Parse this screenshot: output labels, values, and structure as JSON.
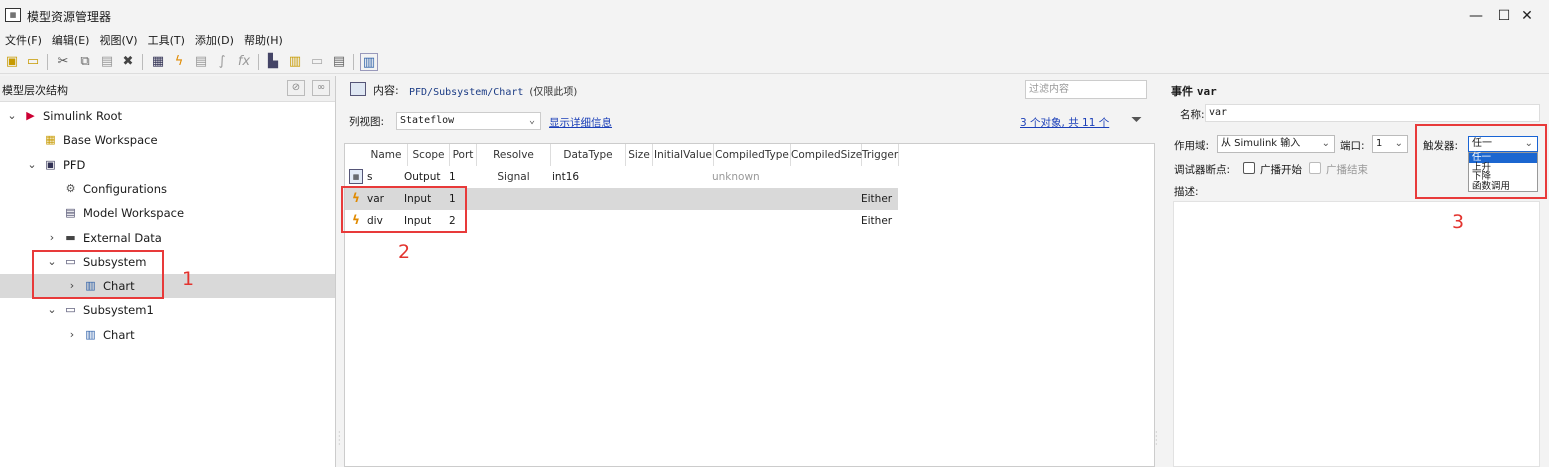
{
  "window": {
    "title": "模型资源管理器",
    "minimize": "—",
    "maximize": "☐",
    "close": "✕"
  },
  "menu": [
    "文件(F)",
    "编辑(E)",
    "视图(V)",
    "工具(T)",
    "添加(D)",
    "帮助(H)"
  ],
  "left": {
    "header": "模型层次结构",
    "tree": [
      {
        "label": "Simulink Root",
        "chev": "v",
        "icon": "simulink-root-icon",
        "level": 0
      },
      {
        "label": "Base Workspace",
        "chev": "",
        "icon": "workspace-icon",
        "level": 1
      },
      {
        "label": "PFD",
        "chev": "v",
        "icon": "model-icon",
        "level": 1
      },
      {
        "label": "Configurations",
        "chev": "",
        "icon": "gear-icon",
        "level": 2
      },
      {
        "label": "Model Workspace",
        "chev": "",
        "icon": "model-workspace-icon",
        "level": 2
      },
      {
        "label": "External Data",
        "chev": ">",
        "icon": "database-icon",
        "level": 2
      },
      {
        "label": "Subsystem",
        "chev": "v",
        "icon": "subsystem-icon",
        "level": 2
      },
      {
        "label": "Chart",
        "chev": ">",
        "icon": "chart-icon",
        "level": 3,
        "selected": true
      },
      {
        "label": "Subsystem1",
        "chev": "v",
        "icon": "subsystem-icon",
        "level": 2
      },
      {
        "label": "Chart",
        "chev": ">",
        "icon": "chart-icon",
        "level": 3
      }
    ]
  },
  "middle": {
    "content_label": "内容:",
    "path": "PFD/Subsystem/Chart",
    "path_suffix": "(仅限此项)",
    "filter_placeholder": "过滤内容",
    "list_view_label": "列视图:",
    "list_view_value": "Stateflow",
    "show_details": "显示详细信息",
    "count": "3 个对象, 共 11 个",
    "columns": [
      "Name",
      "Scope",
      "Port",
      "Resolve Signal",
      "DataType",
      "Size",
      "InitialValue",
      "CompiledType",
      "CompiledSize",
      "Trigger"
    ],
    "rows": [
      {
        "icon": "stateflow-data-icon",
        "name": "s",
        "scope": "Output",
        "port": "1",
        "datatype": "int16",
        "compiledtype": "unknown",
        "trigger": ""
      },
      {
        "icon": "event-icon",
        "name": "var",
        "scope": "Input",
        "port": "1",
        "datatype": "",
        "compiledtype": "",
        "trigger": "Either",
        "selected": true
      },
      {
        "icon": "event-icon",
        "name": "div",
        "scope": "Input",
        "port": "2",
        "datatype": "",
        "compiledtype": "",
        "trigger": "Either"
      }
    ]
  },
  "right": {
    "title_prefix": "事件",
    "title_name": "var",
    "name_label": "名称:",
    "name_value": "var",
    "scope_label": "作用域:",
    "scope_value": "从 Simulink 输入",
    "port_label": "端口:",
    "port_value": "1",
    "trigger_label": "触发器:",
    "trigger_value": "任一",
    "trigger_options": [
      "任一",
      "上升",
      "下降",
      "函数调用"
    ],
    "debug_label": "调试器断点:",
    "bc_start": "广播开始",
    "bc_end": "广播结束",
    "desc_label": "描述:"
  },
  "annotations": [
    "1",
    "2",
    "3"
  ],
  "colors": {
    "annotation": "#e83a3a",
    "link": "#1b3fb8",
    "selection": "#d9d9d9"
  }
}
